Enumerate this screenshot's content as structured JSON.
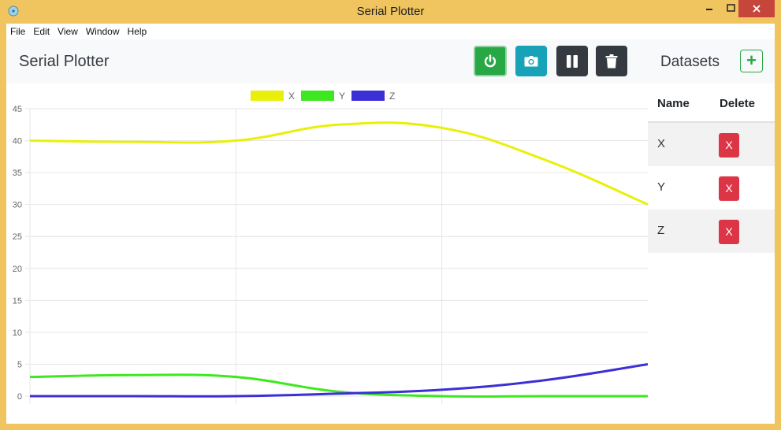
{
  "window": {
    "title": "Serial Plotter",
    "controls": {
      "minimize": "minimize-icon",
      "maximize": "maximize-icon",
      "close": "close-icon"
    }
  },
  "menu": [
    "File",
    "Edit",
    "View",
    "Window",
    "Help"
  ],
  "header": {
    "title": "Serial Plotter",
    "buttons": [
      "power-icon",
      "camera-icon",
      "pause-icon",
      "trash-icon"
    ],
    "datasets_label": "Datasets",
    "add_label": "+"
  },
  "datasets_table": {
    "headers": {
      "name": "Name",
      "delete": "Delete"
    },
    "rows": [
      {
        "name": "X",
        "delete_label": "X"
      },
      {
        "name": "Y",
        "delete_label": "X"
      },
      {
        "name": "Z",
        "delete_label": "X"
      }
    ]
  },
  "colors": {
    "connect": "#28a745",
    "camera": "#17a2b8",
    "dark": "#343a40",
    "danger": "#dc3545",
    "series_x": "#e8f00a",
    "series_y": "#3ee820",
    "series_z": "#3b2fd6"
  },
  "chart_data": {
    "type": "line",
    "x": [
      0,
      1,
      2,
      3,
      4,
      5,
      6
    ],
    "ylim": [
      0,
      45
    ],
    "yticks": [
      0,
      5,
      10,
      15,
      20,
      25,
      30,
      35,
      40,
      45
    ],
    "grid": true,
    "legend_position": "top",
    "series": [
      {
        "name": "X",
        "color": "#e8f00a",
        "values": [
          40,
          39.8,
          40,
          42.5,
          42,
          37,
          30
        ]
      },
      {
        "name": "Y",
        "color": "#3ee820",
        "values": [
          3,
          3.3,
          3,
          0.7,
          0,
          0,
          0
        ]
      },
      {
        "name": "Z",
        "color": "#3b2fd6",
        "values": [
          0,
          0,
          0,
          0.4,
          1,
          2.5,
          5
        ]
      }
    ]
  }
}
